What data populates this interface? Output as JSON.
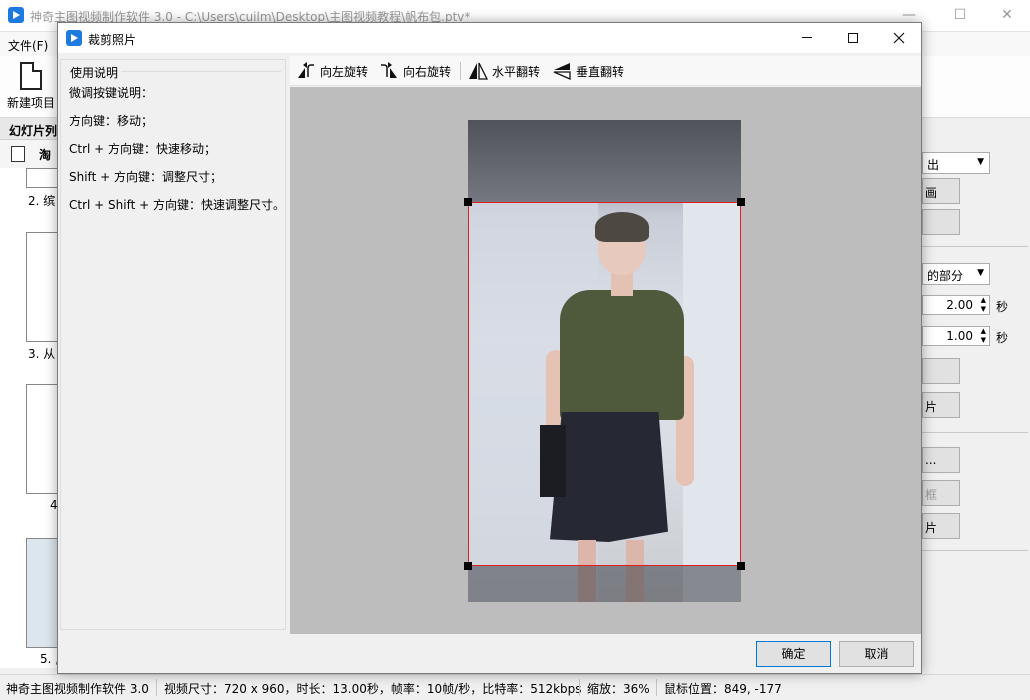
{
  "main_window": {
    "title": "神奇主图视频制作软件 3.0 - C:\\Users\\cuilm\\Desktop\\主图视频教程\\帆布包.ptv*",
    "controls": {
      "minimize": "—",
      "maximize": "☐",
      "close": "✕"
    },
    "menu": {
      "file": "文件(F)"
    },
    "toolbar": {
      "new_project": "新建项目"
    },
    "slide_list": {
      "header": "幻灯片列",
      "tool_label": "淘",
      "thumbnails": [
        {
          "label": "2. 缤"
        },
        {
          "label": "3. 从"
        },
        {
          "label": "4"
        },
        {
          "label": "5. ,"
        }
      ]
    },
    "right_panel": {
      "combo1": "出",
      "button1": "画",
      "combo2": "的部分",
      "spin1": {
        "value": "2.00",
        "unit": "秒"
      },
      "spin2": {
        "value": "1.00",
        "unit": "秒"
      },
      "button2": "片",
      "button3": "...",
      "button4": "框",
      "button5": "片"
    },
    "status_bar": {
      "app_name": "神奇主图视频制作软件 3.0",
      "video_info": "视频尺寸：720 x 960，时长：13.00秒，帧率：10帧/秒，比特率：512kbps",
      "zoom": "缩放：36%",
      "mouse_position": "鼠标位置：849, -177"
    }
  },
  "dialog": {
    "title": "裁剪照片",
    "help": {
      "heading": "使用说明",
      "lines": [
        "微调按键说明：",
        "方向键：移动；",
        "Ctrl + 方向键：快速移动；",
        "Shift + 方向键：调整尺寸；",
        "Ctrl + Shift + 方向键：快速调整尺寸。"
      ]
    },
    "toolbar": {
      "rotate_left": "向左旋转",
      "rotate_right": "向右旋转",
      "flip_horizontal": "水平翻转",
      "flip_vertical": "垂直翻转"
    },
    "buttons": {
      "ok": "确定",
      "cancel": "取消"
    }
  }
}
